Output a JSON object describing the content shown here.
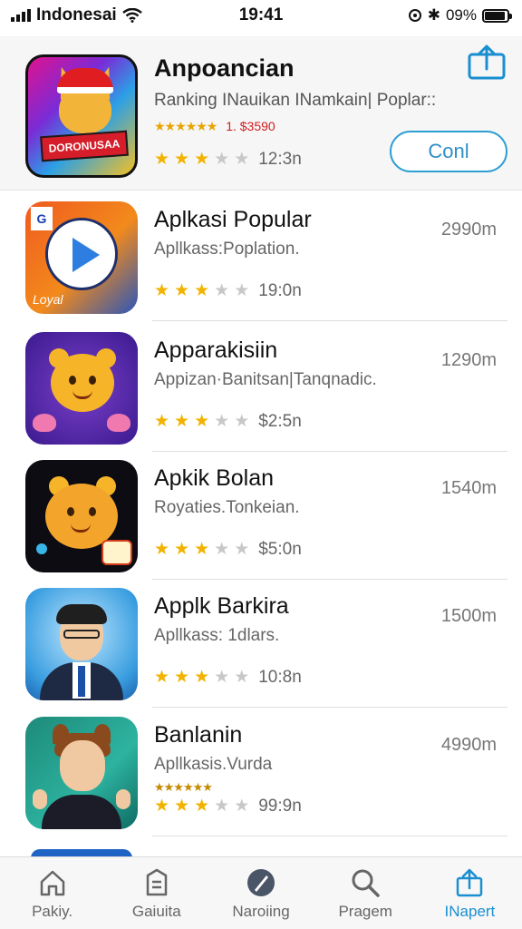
{
  "status_bar": {
    "carrier": "Indonesai",
    "time": "19:41",
    "battery": "09%"
  },
  "header": {
    "title": "Anpoancian",
    "subtitle": "Ranking INauikan INamkain| Poplar::",
    "mini_stars": "★★★★★★",
    "mini_text": "1. $3590",
    "icon_banner": "DORONUSAA",
    "rating": 3,
    "meta": "12:3n",
    "button_label": "Conl"
  },
  "apps": [
    {
      "title": "Aplkasi Popular",
      "subtitle": "Apllkass:Poplation.",
      "size": "2990m",
      "rating": 3,
      "meta": "19:0n",
      "icon_text": "Loyal"
    },
    {
      "title": "Apparakisiin",
      "subtitle": "Appizan·Banitsan|Tanqnadic.",
      "size": "1290m",
      "rating": 3,
      "meta": "$2:5n",
      "icon_text": ""
    },
    {
      "title": "Apkik Bolan",
      "subtitle": "Royaties.Tonkeian.",
      "size": "1540m",
      "rating": 3,
      "meta": "$5:0n",
      "icon_text": ""
    },
    {
      "title": "Applk Barkira",
      "subtitle": "Apllkass: 1dlars.",
      "size": "1500m",
      "rating": 3,
      "meta": "10:8n",
      "icon_text": ""
    },
    {
      "title": "Banlanin",
      "subtitle": "Apllkasis.Vurda",
      "size": "4990m",
      "rating": 3,
      "meta": "99:9n",
      "icon_text": "",
      "extra": "★★★★★★"
    }
  ],
  "bottom_nav": [
    {
      "label": "Pakiy.",
      "icon": "home-icon"
    },
    {
      "label": "Gaiuita",
      "icon": "list-icon"
    },
    {
      "label": "Naroiing",
      "icon": "compass-icon"
    },
    {
      "label": "Pragem",
      "icon": "search-icon"
    },
    {
      "label": "INapert",
      "icon": "share-icon",
      "active": true
    }
  ],
  "colors": {
    "accent": "#1a8fd0",
    "star": "#f2b200",
    "star_off": "#c8c8c8"
  }
}
